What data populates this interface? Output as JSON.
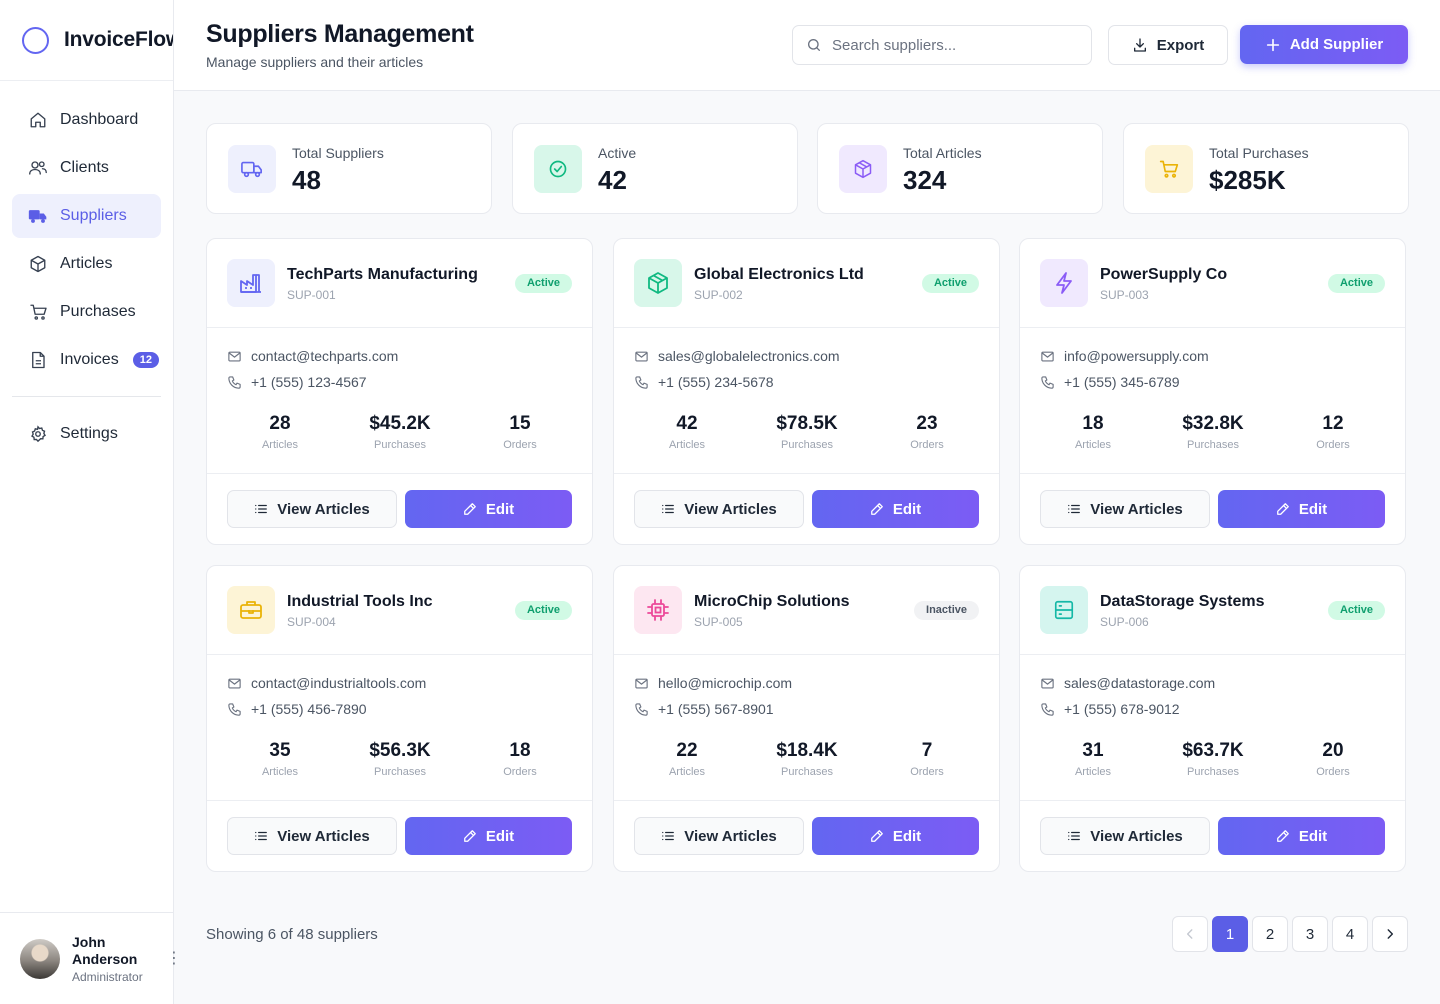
{
  "app": {
    "name": "InvoiceFlow"
  },
  "sidebar": {
    "items": [
      {
        "label": "Dashboard",
        "icon": "home-icon"
      },
      {
        "label": "Clients",
        "icon": "users-icon"
      },
      {
        "label": "Suppliers",
        "icon": "truck-icon",
        "active": true
      },
      {
        "label": "Articles",
        "icon": "box-icon"
      },
      {
        "label": "Purchases",
        "icon": "cart-icon"
      },
      {
        "label": "Invoices",
        "icon": "document-icon",
        "badge": "12"
      }
    ],
    "settings_label": "Settings"
  },
  "user": {
    "name": "John Anderson",
    "role": "Administrator"
  },
  "header": {
    "title": "Suppliers Management",
    "subtitle": "Manage suppliers and their articles",
    "search_placeholder": "Search suppliers...",
    "export_label": "Export",
    "add_label": "Add Supplier"
  },
  "stats": [
    {
      "label": "Total Suppliers",
      "value": "48",
      "icon": "truck-icon",
      "color": "#6366f1",
      "bg": "#eef0fd"
    },
    {
      "label": "Active",
      "value": "42",
      "icon": "check-circle-icon",
      "color": "#10b981",
      "bg": "#d8f7ea"
    },
    {
      "label": "Total Articles",
      "value": "324",
      "icon": "box-icon",
      "color": "#8b5cf6",
      "bg": "#f0e9fe"
    },
    {
      "label": "Total Purchases",
      "value": "$285K",
      "icon": "cart-icon",
      "color": "#eab308",
      "bg": "#fdf4d6"
    }
  ],
  "suppliers": [
    {
      "name": "TechParts Manufacturing",
      "code": "SUP-001",
      "status": "Active",
      "email": "contact@techparts.com",
      "phone": "+1 (555) 123-4567",
      "articles": "28",
      "purchases": "$45.2K",
      "orders": "15",
      "icon": "factory-icon",
      "color": "#6366f1",
      "bg": "#eef0fd"
    },
    {
      "name": "Global Electronics Ltd",
      "code": "SUP-002",
      "status": "Active",
      "email": "sales@globalelectronics.com",
      "phone": "+1 (555) 234-5678",
      "articles": "42",
      "purchases": "$78.5K",
      "orders": "23",
      "icon": "package-icon",
      "color": "#10b981",
      "bg": "#d8f7ea"
    },
    {
      "name": "PowerSupply Co",
      "code": "SUP-003",
      "status": "Active",
      "email": "info@powersupply.com",
      "phone": "+1 (555) 345-6789",
      "articles": "18",
      "purchases": "$32.8K",
      "orders": "12",
      "icon": "lightning-icon",
      "color": "#8b5cf6",
      "bg": "#f0e9fe"
    },
    {
      "name": "Industrial Tools Inc",
      "code": "SUP-004",
      "status": "Active",
      "email": "contact@industrialtools.com",
      "phone": "+1 (555) 456-7890",
      "articles": "35",
      "purchases": "$56.3K",
      "orders": "18",
      "icon": "toolbox-icon",
      "color": "#eab308",
      "bg": "#fdf4d6"
    },
    {
      "name": "MicroChip Solutions",
      "code": "SUP-005",
      "status": "Inactive",
      "email": "hello@microchip.com",
      "phone": "+1 (555) 567-8901",
      "articles": "22",
      "purchases": "$18.4K",
      "orders": "7",
      "icon": "chip-icon",
      "color": "#ec4899",
      "bg": "#fde7f1"
    },
    {
      "name": "DataStorage Systems",
      "code": "SUP-006",
      "status": "Active",
      "email": "sales@datastorage.com",
      "phone": "+1 (555) 678-9012",
      "articles": "31",
      "purchases": "$63.7K",
      "orders": "20",
      "icon": "server-icon",
      "color": "#14b8a6",
      "bg": "#d5f5ef"
    }
  ],
  "metric_labels": {
    "articles": "Articles",
    "purchases": "Purchases",
    "orders": "Orders"
  },
  "buttons": {
    "view": "View Articles",
    "edit": "Edit"
  },
  "pagination": {
    "showing": "Showing 6 of 48 suppliers",
    "pages": [
      "1",
      "2",
      "3",
      "4"
    ],
    "current": "1"
  }
}
